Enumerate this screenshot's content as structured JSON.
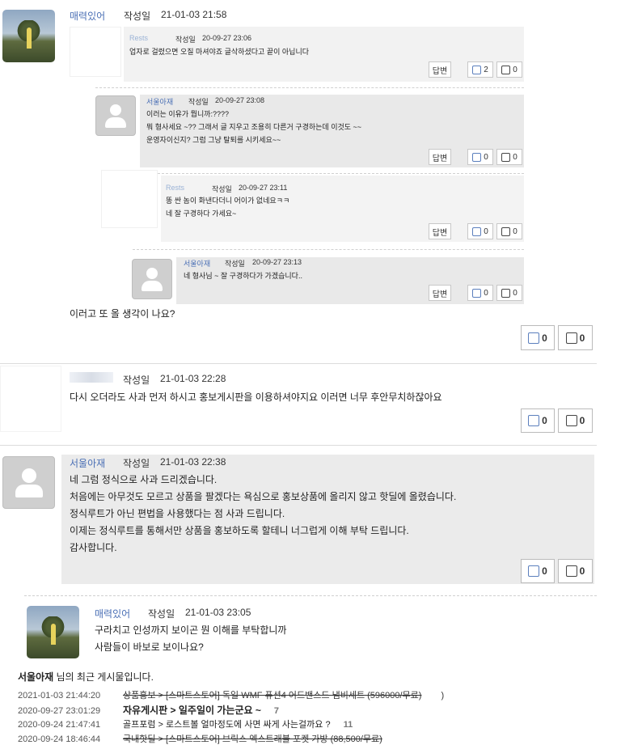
{
  "comments": [
    {
      "author": "매력있어",
      "label": "작성일",
      "date": "21-01-03 21:58",
      "quoted": [
        {
          "author": "Rests",
          "label": "작성일",
          "date": "20-09-27 23:06",
          "lines": [
            "업자로 걸렸으면 오질 마셔야죠 글삭하셨다고 끝이 아닙니다"
          ],
          "reply": "답변",
          "up": "2",
          "down": "0"
        },
        {
          "author": "서울아재",
          "label": "작성일",
          "date": "20-09-27 23:08",
          "lines": [
            "이러는 이유가 뭡니까:????",
            "뭐 형사세요 ~?? 그래서 글 지우고 조용히 다른거 구경하는데 이것도 ~~",
            "운영자이신지? 그럼 그냥 탈퇴를 시키세요~~"
          ],
          "reply": "답변",
          "up": "0",
          "down": "0"
        },
        {
          "author": "Rests",
          "label": "작성일",
          "date": "20-09-27 23:11",
          "lines": [
            "똥 싼 놈이 화낸다더니 어이가 없네요ㅋㅋ",
            "네 잘 구경하다 가세요~"
          ],
          "reply": "답변",
          "up": "0",
          "down": "0"
        },
        {
          "author": "서울아재",
          "label": "작성일",
          "date": "20-09-27 23:13",
          "lines": [
            "네 형사님 ~ 잘 구경하다가 가겠습니다.."
          ],
          "reply": "답변",
          "up": "0",
          "down": "0"
        }
      ],
      "body": [
        "이러고 또 올 생각이 나요?"
      ],
      "up": "0",
      "down": "0"
    },
    {
      "author": "",
      "label": "작성일",
      "date": "21-01-03 22:28",
      "body": [
        "다시 오더라도 사과 먼저 하시고 홍보게시판을 이용하셔야지요 이러면 너무 후안무치하잖아요"
      ],
      "up": "0",
      "down": "0"
    },
    {
      "author": "서울아재",
      "label": "작성일",
      "date": "21-01-03 22:38",
      "body": [
        "네 그럼 정식으로 사과 드리겠습니다.",
        "처음에는 아무것도 모르고 상품을 팔겠다는 욕심으로 홍보상품에 올리지 않고 핫딜에 올렸습니다.",
        "정식루트가 아닌 편법을 사용했다는 점 사과 드립니다.",
        "이제는 정식루트를 통해서만 상품을 홍보하도록 할테니 너그럽게 이해 부탁 드립니다.",
        "감사합니다."
      ],
      "up": "0",
      "down": "0"
    },
    {
      "author": "매력있어",
      "label": "작성일",
      "date": "21-01-03 23:05",
      "body": [
        "구라치고 인성까지 보이곤 뭔 이해를 부탁합니까",
        "사람들이 바보로 보이나요?"
      ]
    }
  ],
  "recent": {
    "user": "서울아재",
    "suffix": " 님의 최근 게시물입니다.",
    "items": [
      {
        "date": "2021-01-03 21:44:20",
        "title": "상품홍보 > [스마트스토어] 독일 WMF 퓨션4 어드밴스드 냄비세트 (596000/무료)",
        "count": "",
        "struck": true,
        "bold": false
      },
      {
        "date": "2020-09-27 23:01:29",
        "title": "자유게시판 > 일주일이 가는군요 ~",
        "count": "7",
        "struck": false,
        "bold": true
      },
      {
        "date": "2020-09-24 21:47:41",
        "title": "골프포럼 > 로스트볼 얼마정도에 사면 싸게 사는걸까요 ?",
        "count": "11",
        "struck": false,
        "bold": false
      },
      {
        "date": "2020-09-24 18:46:44",
        "title": "국내핫딜 > [스마트스토어] 브릭스 엑스트래블 포켓 가방 (88,500/무료)",
        "count": "",
        "struck": true,
        "bold": false
      }
    ]
  }
}
